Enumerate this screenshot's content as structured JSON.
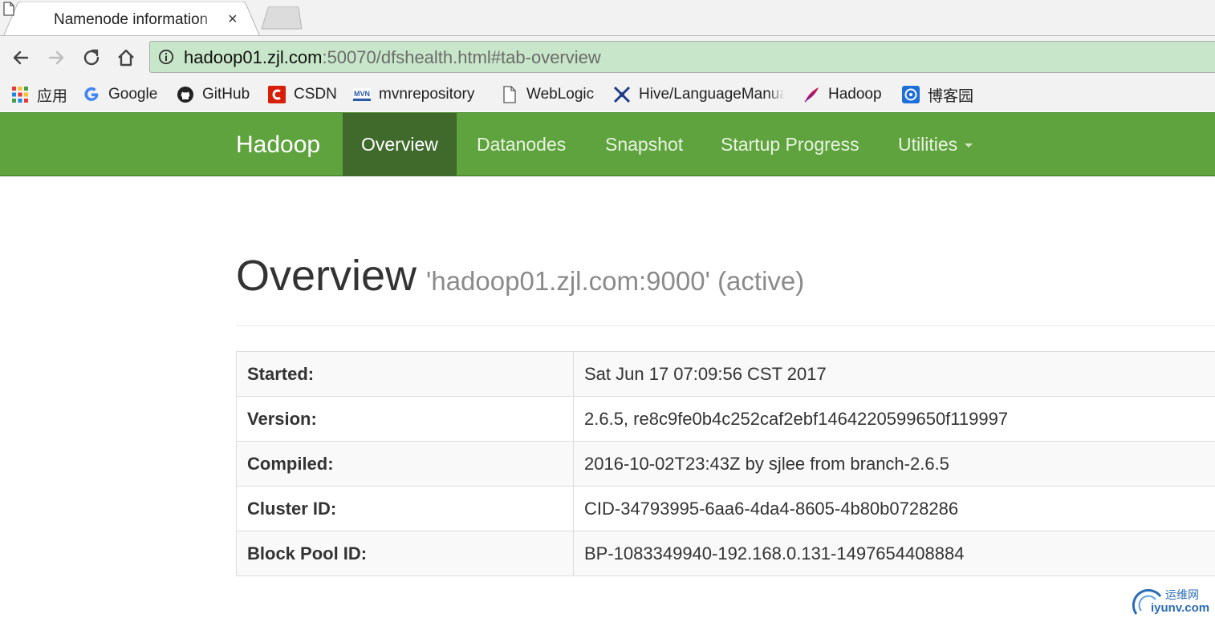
{
  "browser": {
    "tab_title": "Namenode information",
    "tab_close": "×",
    "url_host": "hadoop01.zjl.com",
    "url_rest": ":50070/dfshealth.html#tab-overview"
  },
  "bookmarks": [
    {
      "label": "应用",
      "icon": "apps-grid-icon"
    },
    {
      "label": "Google",
      "icon": "google-icon"
    },
    {
      "label": "GitHub",
      "icon": "github-icon"
    },
    {
      "label": "CSDN",
      "icon": "csdn-icon"
    },
    {
      "label": "mvnrepository",
      "icon": "mvn-icon"
    },
    {
      "label": "WebLogic",
      "icon": "page-icon"
    },
    {
      "label": "Hive/LanguageManual",
      "icon": "hive-icon"
    },
    {
      "label": "Hadoop",
      "icon": "feather-icon"
    },
    {
      "label": "博客园",
      "icon": "cnblogs-icon"
    }
  ],
  "navbar": {
    "brand": "Hadoop",
    "items": [
      {
        "label": "Overview",
        "active": true
      },
      {
        "label": "Datanodes"
      },
      {
        "label": "Snapshot"
      },
      {
        "label": "Startup Progress"
      },
      {
        "label": "Utilities"
      }
    ]
  },
  "overview": {
    "title": "Overview",
    "subtitle": "'hadoop01.zjl.com:9000' (active)",
    "rows": [
      {
        "key": "Started:",
        "value": "Sat Jun 17 07:09:56 CST 2017"
      },
      {
        "key": "Version:",
        "value": "2.6.5, re8c9fe0b4c252caf2ebf1464220599650f119997"
      },
      {
        "key": "Compiled:",
        "value": "2016-10-02T23:43Z by sjlee from branch-2.6.5"
      },
      {
        "key": "Cluster ID:",
        "value": "CID-34793995-6aa6-4da4-8605-4b80b0728286"
      },
      {
        "key": "Block Pool ID:",
        "value": "BP-1083349940-192.168.0.131-1497654408884"
      }
    ]
  },
  "watermark": {
    "cn": "运维网",
    "en": "iyunv.com"
  },
  "colors": {
    "navbar": "#5fa33e",
    "navbar_active": "#3f6a2c",
    "omnibox": "#c8e6c9"
  }
}
